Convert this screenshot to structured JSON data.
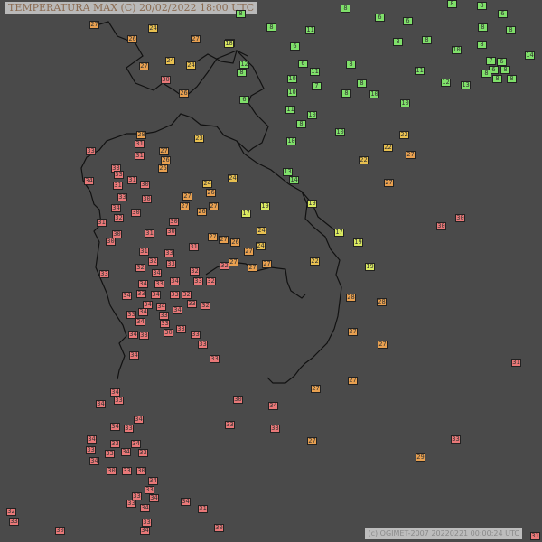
{
  "title": "TEMPERATURA MAX (C)   20/02/2022 18:00 UTC",
  "credit": "(c) OGIMET-2007 20220221 00:00:24 UTC",
  "palette": {
    "background": "#4a4a4a",
    "border_line": "#111111",
    "t_le_14": "#7fe06a",
    "t_15_19": "#d9e860",
    "t_20_24": "#e8c050",
    "t_25_29": "#e8a050",
    "t_30_34": "#e87878",
    "t_ge_35": "#f04a70"
  },
  "stations": [
    {
      "value": "8",
      "lon": 266,
      "lat": 15
    },
    {
      "value": "8",
      "lon": 382,
      "lat": 9
    },
    {
      "value": "6",
      "lon": 420,
      "lat": 19
    },
    {
      "value": "6",
      "lon": 451,
      "lat": 23
    },
    {
      "value": "8",
      "lon": 500,
      "lat": 4
    },
    {
      "value": "8",
      "lon": 533,
      "lat": 6
    },
    {
      "value": "6",
      "lon": 556,
      "lat": 15
    },
    {
      "value": "8",
      "lon": 565,
      "lat": 33
    },
    {
      "value": "8",
      "lon": 300,
      "lat": 30
    },
    {
      "value": "11",
      "lon": 343,
      "lat": 33
    },
    {
      "value": "6",
      "lon": 326,
      "lat": 51
    },
    {
      "value": "8",
      "lon": 440,
      "lat": 46
    },
    {
      "value": "8",
      "lon": 472,
      "lat": 44
    },
    {
      "value": "8",
      "lon": 534,
      "lat": 30
    },
    {
      "value": "8",
      "lon": 533,
      "lat": 49
    },
    {
      "value": "10",
      "lon": 505,
      "lat": 55
    },
    {
      "value": "14",
      "lon": 586,
      "lat": 61
    },
    {
      "value": "7",
      "lon": 543,
      "lat": 67
    },
    {
      "value": "6",
      "lon": 555,
      "lat": 68
    },
    {
      "value": "6",
      "lon": 546,
      "lat": 77
    },
    {
      "value": "8",
      "lon": 559,
      "lat": 77
    },
    {
      "value": "8",
      "lon": 538,
      "lat": 81
    },
    {
      "value": "8",
      "lon": 550,
      "lat": 87
    },
    {
      "value": "8",
      "lon": 566,
      "lat": 87
    },
    {
      "value": "11",
      "lon": 464,
      "lat": 78
    },
    {
      "value": "12",
      "lon": 493,
      "lat": 91
    },
    {
      "value": "13",
      "lon": 515,
      "lat": 94
    },
    {
      "value": "14",
      "lon": 254,
      "lat": 47
    },
    {
      "value": "12",
      "lon": 270,
      "lat": 71
    },
    {
      "value": "8",
      "lon": 267,
      "lat": 80
    },
    {
      "value": "6",
      "lon": 335,
      "lat": 70
    },
    {
      "value": "11",
      "lon": 348,
      "lat": 79
    },
    {
      "value": "8",
      "lon": 388,
      "lat": 71
    },
    {
      "value": "10",
      "lon": 323,
      "lat": 87
    },
    {
      "value": "7",
      "lon": 350,
      "lat": 95
    },
    {
      "value": "10",
      "lon": 323,
      "lat": 102
    },
    {
      "value": "8",
      "lon": 383,
      "lat": 103
    },
    {
      "value": "8",
      "lon": 400,
      "lat": 92
    },
    {
      "value": "10",
      "lon": 414,
      "lat": 104
    },
    {
      "value": "6",
      "lon": 270,
      "lat": 110
    },
    {
      "value": "11",
      "lon": 321,
      "lat": 121
    },
    {
      "value": "10",
      "lon": 345,
      "lat": 127
    },
    {
      "value": "8",
      "lon": 333,
      "lat": 137
    },
    {
      "value": "10",
      "lon": 448,
      "lat": 114
    },
    {
      "value": "10",
      "lon": 376,
      "lat": 146
    },
    {
      "value": "10",
      "lon": 322,
      "lat": 156
    },
    {
      "value": "13",
      "lon": 318,
      "lat": 190
    },
    {
      "value": "14",
      "lon": 325,
      "lat": 199
    },
    {
      "value": "18",
      "lon": 253,
      "lat": 48
    },
    {
      "value": "23",
      "lon": 220,
      "lat": 153
    },
    {
      "value": "22",
      "lon": 447,
      "lat": 149
    },
    {
      "value": "22",
      "lon": 429,
      "lat": 163
    },
    {
      "value": "22",
      "lon": 402,
      "lat": 177
    },
    {
      "value": "19",
      "lon": 345,
      "lat": 225
    },
    {
      "value": "19",
      "lon": 293,
      "lat": 228
    },
    {
      "value": "17",
      "lon": 272,
      "lat": 236
    },
    {
      "value": "17",
      "lon": 375,
      "lat": 257
    },
    {
      "value": "19",
      "lon": 396,
      "lat": 268
    },
    {
      "value": "19",
      "lon": 409,
      "lat": 295
    },
    {
      "value": "24",
      "lon": 289,
      "lat": 255
    },
    {
      "value": "24",
      "lon": 288,
      "lat": 272
    },
    {
      "value": "22",
      "lon": 348,
      "lat": 289
    },
    {
      "value": "27",
      "lon": 104,
      "lat": 27
    },
    {
      "value": "24",
      "lon": 169,
      "lat": 31
    },
    {
      "value": "26",
      "lon": 146,
      "lat": 43
    },
    {
      "value": "27",
      "lon": 216,
      "lat": 43
    },
    {
      "value": "27",
      "lon": 159,
      "lat": 73
    },
    {
      "value": "24",
      "lon": 188,
      "lat": 67
    },
    {
      "value": "24",
      "lon": 211,
      "lat": 72
    },
    {
      "value": "26",
      "lon": 203,
      "lat": 103
    },
    {
      "value": "28",
      "lon": 156,
      "lat": 149
    },
    {
      "value": "27",
      "lon": 181,
      "lat": 167
    },
    {
      "value": "26",
      "lon": 183,
      "lat": 177
    },
    {
      "value": "26",
      "lon": 180,
      "lat": 186
    },
    {
      "value": "24",
      "lon": 257,
      "lat": 197
    },
    {
      "value": "24",
      "lon": 229,
      "lat": 203
    },
    {
      "value": "27",
      "lon": 207,
      "lat": 217
    },
    {
      "value": "26",
      "lon": 233,
      "lat": 213
    },
    {
      "value": "27",
      "lon": 204,
      "lat": 228
    },
    {
      "value": "26",
      "lon": 223,
      "lat": 234
    },
    {
      "value": "27",
      "lon": 236,
      "lat": 228
    },
    {
      "value": "27",
      "lon": 454,
      "lat": 171
    },
    {
      "value": "27",
      "lon": 430,
      "lat": 202
    },
    {
      "value": "26",
      "lon": 260,
      "lat": 268
    },
    {
      "value": "27",
      "lon": 275,
      "lat": 278
    },
    {
      "value": "27",
      "lon": 247,
      "lat": 265
    },
    {
      "value": "27",
      "lon": 235,
      "lat": 262
    },
    {
      "value": "27",
      "lon": 258,
      "lat": 290
    },
    {
      "value": "27",
      "lon": 279,
      "lat": 296
    },
    {
      "value": "27",
      "lon": 295,
      "lat": 292
    },
    {
      "value": "28",
      "lon": 422,
      "lat": 334
    },
    {
      "value": "28",
      "lon": 388,
      "lat": 329
    },
    {
      "value": "27",
      "lon": 390,
      "lat": 367
    },
    {
      "value": "27",
      "lon": 423,
      "lat": 381
    },
    {
      "value": "27",
      "lon": 390,
      "lat": 421
    },
    {
      "value": "27",
      "lon": 349,
      "lat": 430
    },
    {
      "value": "27",
      "lon": 345,
      "lat": 488
    },
    {
      "value": "29",
      "lon": 465,
      "lat": 506
    },
    {
      "value": "30",
      "lon": 183,
      "lat": 88
    },
    {
      "value": "31",
      "lon": 154,
      "lat": 159
    },
    {
      "value": "30",
      "lon": 160,
      "lat": 204
    },
    {
      "value": "31",
      "lon": 146,
      "lat": 199
    },
    {
      "value": "30",
      "lon": 162,
      "lat": 220
    },
    {
      "value": "31",
      "lon": 130,
      "lat": 205
    },
    {
      "value": "31",
      "lon": 154,
      "lat": 172
    },
    {
      "value": "30",
      "lon": 150,
      "lat": 235
    },
    {
      "value": "30",
      "lon": 192,
      "lat": 245
    },
    {
      "value": "31",
      "lon": 165,
      "lat": 258
    },
    {
      "value": "30",
      "lon": 189,
      "lat": 256
    },
    {
      "value": "31",
      "lon": 214,
      "lat": 273
    },
    {
      "value": "30",
      "lon": 122,
      "lat": 267
    },
    {
      "value": "31",
      "lon": 112,
      "lat": 246
    },
    {
      "value": "30",
      "lon": 129,
      "lat": 259
    },
    {
      "value": "30",
      "lon": 488,
      "lat": 250
    },
    {
      "value": "30",
      "lon": 509,
      "lat": 241
    },
    {
      "value": "30",
      "lon": 263,
      "lat": 442
    },
    {
      "value": "31",
      "lon": 224,
      "lat": 563
    },
    {
      "value": "30",
      "lon": 66,
      "lat": 587
    },
    {
      "value": "30",
      "lon": 242,
      "lat": 584
    },
    {
      "value": "31",
      "lon": 571,
      "lat": 401
    },
    {
      "value": "31",
      "lon": 592,
      "lat": 593
    },
    {
      "value": "32",
      "lon": 12,
      "lat": 566
    },
    {
      "value": "33",
      "lon": 100,
      "lat": 167
    },
    {
      "value": "33",
      "lon": 128,
      "lat": 186
    },
    {
      "value": "33",
      "lon": 131,
      "lat": 193
    },
    {
      "value": "34",
      "lon": 98,
      "lat": 200
    },
    {
      "value": "33",
      "lon": 135,
      "lat": 218
    },
    {
      "value": "34",
      "lon": 128,
      "lat": 230
    },
    {
      "value": "32",
      "lon": 131,
      "lat": 241
    },
    {
      "value": "31",
      "lon": 159,
      "lat": 278
    },
    {
      "value": "32",
      "lon": 169,
      "lat": 289
    },
    {
      "value": "33",
      "lon": 187,
      "lat": 280
    },
    {
      "value": "33",
      "lon": 189,
      "lat": 292
    },
    {
      "value": "32",
      "lon": 155,
      "lat": 296
    },
    {
      "value": "34",
      "lon": 173,
      "lat": 302
    },
    {
      "value": "33",
      "lon": 115,
      "lat": 303
    },
    {
      "value": "32",
      "lon": 215,
      "lat": 300
    },
    {
      "value": "34",
      "lon": 158,
      "lat": 314
    },
    {
      "value": "33",
      "lon": 176,
      "lat": 314
    },
    {
      "value": "34",
      "lon": 193,
      "lat": 311
    },
    {
      "value": "33",
      "lon": 219,
      "lat": 311
    },
    {
      "value": "32",
      "lon": 233,
      "lat": 311
    },
    {
      "value": "34",
      "lon": 140,
      "lat": 327
    },
    {
      "value": "33",
      "lon": 156,
      "lat": 325
    },
    {
      "value": "34",
      "lon": 172,
      "lat": 326
    },
    {
      "value": "33",
      "lon": 193,
      "lat": 326
    },
    {
      "value": "32",
      "lon": 206,
      "lat": 326
    },
    {
      "value": "34",
      "lon": 163,
      "lat": 337
    },
    {
      "value": "34",
      "lon": 178,
      "lat": 339
    },
    {
      "value": "33",
      "lon": 212,
      "lat": 336
    },
    {
      "value": "32",
      "lon": 227,
      "lat": 338
    },
    {
      "value": "33",
      "lon": 145,
      "lat": 348
    },
    {
      "value": "34",
      "lon": 158,
      "lat": 345
    },
    {
      "value": "33",
      "lon": 181,
      "lat": 349
    },
    {
      "value": "34",
      "lon": 196,
      "lat": 343
    },
    {
      "value": "34",
      "lon": 155,
      "lat": 356
    },
    {
      "value": "33",
      "lon": 182,
      "lat": 358
    },
    {
      "value": "33",
      "lon": 200,
      "lat": 364
    },
    {
      "value": "34",
      "lon": 147,
      "lat": 370
    },
    {
      "value": "33",
      "lon": 159,
      "lat": 371
    },
    {
      "value": "30",
      "lon": 186,
      "lat": 368
    },
    {
      "value": "33",
      "lon": 216,
      "lat": 370
    },
    {
      "value": "33",
      "lon": 224,
      "lat": 381
    },
    {
      "value": "34",
      "lon": 148,
      "lat": 393
    },
    {
      "value": "33",
      "lon": 237,
      "lat": 397
    },
    {
      "value": "32",
      "lon": 248,
      "lat": 294
    },
    {
      "value": "34",
      "lon": 127,
      "lat": 434
    },
    {
      "value": "33",
      "lon": 131,
      "lat": 443
    },
    {
      "value": "34",
      "lon": 111,
      "lat": 447
    },
    {
      "value": "34",
      "lon": 153,
      "lat": 464
    },
    {
      "value": "34",
      "lon": 127,
      "lat": 472
    },
    {
      "value": "33",
      "lon": 142,
      "lat": 474
    },
    {
      "value": "33",
      "lon": 254,
      "lat": 470
    },
    {
      "value": "34",
      "lon": 302,
      "lat": 449
    },
    {
      "value": "33",
      "lon": 304,
      "lat": 474
    },
    {
      "value": "33",
      "lon": 504,
      "lat": 486
    },
    {
      "value": "34",
      "lon": 101,
      "lat": 486
    },
    {
      "value": "33",
      "lon": 127,
      "lat": 491
    },
    {
      "value": "34",
      "lon": 150,
      "lat": 491
    },
    {
      "value": "33",
      "lon": 100,
      "lat": 498
    },
    {
      "value": "33",
      "lon": 121,
      "lat": 502
    },
    {
      "value": "34",
      "lon": 139,
      "lat": 500
    },
    {
      "value": "33",
      "lon": 158,
      "lat": 501
    },
    {
      "value": "34",
      "lon": 104,
      "lat": 510
    },
    {
      "value": "30",
      "lon": 123,
      "lat": 521
    },
    {
      "value": "33",
      "lon": 140,
      "lat": 521
    },
    {
      "value": "30",
      "lon": 156,
      "lat": 521
    },
    {
      "value": "34",
      "lon": 169,
      "lat": 532
    },
    {
      "value": "33",
      "lon": 165,
      "lat": 542
    },
    {
      "value": "33",
      "lon": 151,
      "lat": 549
    },
    {
      "value": "34",
      "lon": 170,
      "lat": 551
    },
    {
      "value": "33",
      "lon": 145,
      "lat": 557
    },
    {
      "value": "34",
      "lon": 160,
      "lat": 562
    },
    {
      "value": "34",
      "lon": 205,
      "lat": 555
    },
    {
      "value": "33",
      "lon": 162,
      "lat": 578
    },
    {
      "value": "34",
      "lon": 160,
      "lat": 587
    },
    {
      "value": "33",
      "lon": 15,
      "lat": 577
    }
  ]
}
